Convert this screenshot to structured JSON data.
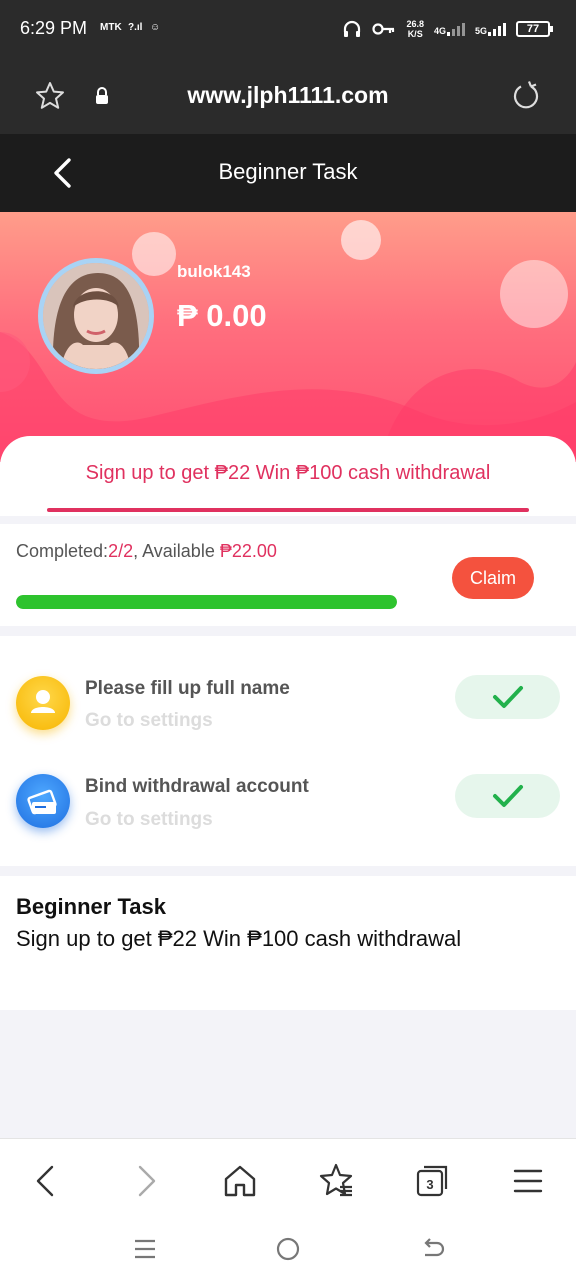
{
  "status_bar": {
    "time": "6:29 PM",
    "carrier_tag": "MTK",
    "net_speed_value": "26.8",
    "net_speed_unit": "K/S",
    "net_4g": "4G",
    "net_5g": "5G",
    "battery": "77"
  },
  "browser": {
    "url": "www.jlph1111.com",
    "tabs_count": "3"
  },
  "page": {
    "title": "Beginner Task"
  },
  "profile": {
    "username": "bulok143",
    "balance": "₱ 0.00"
  },
  "tab": {
    "label": "Sign up to get ₱22  Win ₱100 cash withdrawal"
  },
  "progress": {
    "completed_label": "Completed:",
    "completed_value": "2/2",
    "available_label": ", Available ",
    "available_value": "₱22.00",
    "fraction": 1.0,
    "claim_label": "Claim"
  },
  "tasks": [
    {
      "title": "Please fill up full name",
      "subtitle": "Go to settings",
      "icon": "user-icon",
      "done": true
    },
    {
      "title": "Bind withdrawal account",
      "subtitle": "Go to settings",
      "icon": "card-icon",
      "done": true
    }
  ],
  "description": {
    "title": "Beginner Task",
    "body": "Sign up to get ₱22 Win ₱100 cash withdrawal"
  },
  "colors": {
    "accent": "#e0315f",
    "claim": "#f4523e",
    "progress_fill": "#2ec32e",
    "check": "#22b14c"
  }
}
